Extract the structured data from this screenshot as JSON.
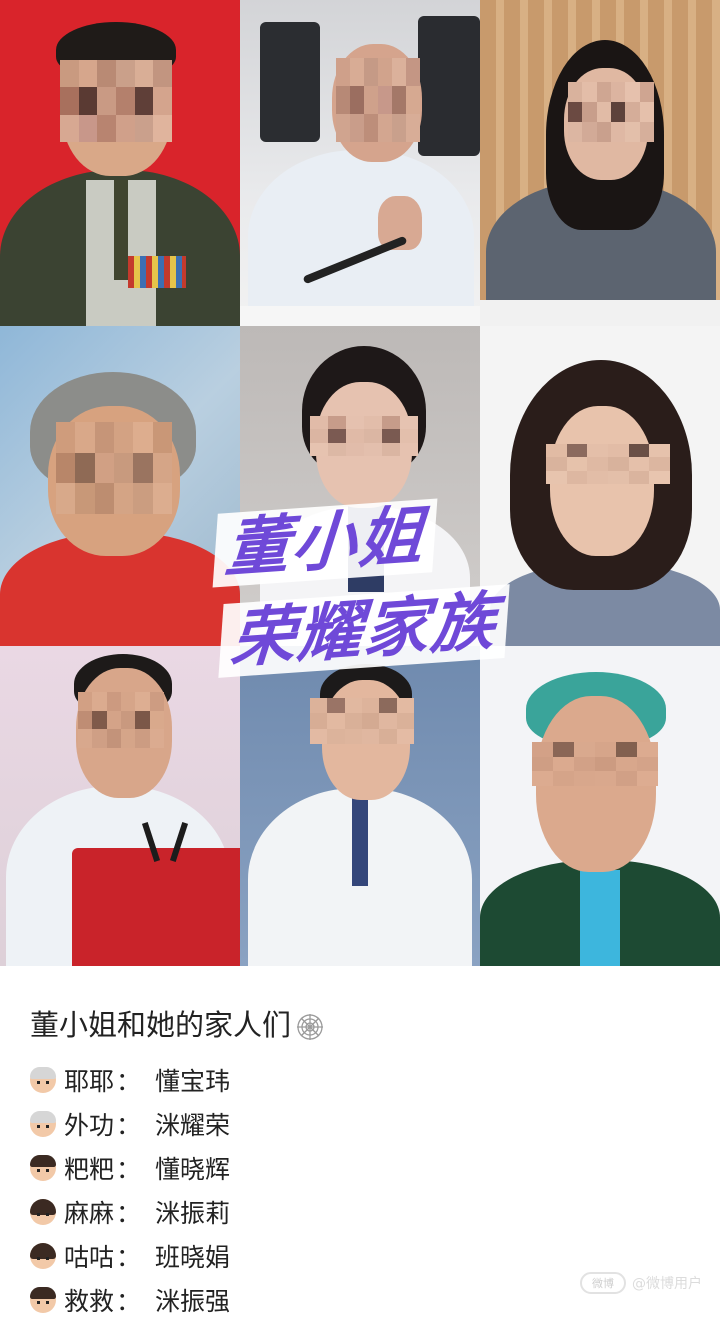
{
  "overlay": {
    "line1": "董小姐",
    "line2": "荣耀家族",
    "color": "#6f49d8"
  },
  "caption": {
    "title": "董小姐和她的家人们",
    "title_icon": "spider-web-icon",
    "members": [
      {
        "icon": "older-man-emoji-icon",
        "relation": "耶耶",
        "name": "懂宝玮"
      },
      {
        "icon": "older-man-emoji-icon",
        "relation": "外功",
        "name": "洣耀荣"
      },
      {
        "icon": "man-emoji-icon",
        "relation": "粑粑",
        "name": "懂晓辉"
      },
      {
        "icon": "woman-emoji-icon",
        "relation": "麻麻",
        "name": "洣振莉"
      },
      {
        "icon": "woman-emoji-icon",
        "relation": "咕咕",
        "name": "班晓娟"
      },
      {
        "icon": "man-emoji-icon",
        "relation": "救救",
        "name": "洣振强"
      }
    ],
    "colon": "："
  },
  "photos": [
    {
      "id": "photo-1",
      "background": "#d9242b"
    },
    {
      "id": "photo-2",
      "background": "#e7e8ea"
    },
    {
      "id": "photo-3",
      "background": "#c79a6a"
    },
    {
      "id": "photo-4",
      "background": "#7faad0"
    },
    {
      "id": "photo-5",
      "background": "#c9c6c4"
    },
    {
      "id": "photo-6",
      "background": "#f4f4f4"
    },
    {
      "id": "photo-7",
      "background": "#e6dbe2"
    },
    {
      "id": "photo-8",
      "background": "#7d96b6"
    },
    {
      "id": "photo-9",
      "background": "#f3f4f7"
    }
  ],
  "watermark": {
    "logo": "微博",
    "text": "@微博用户"
  }
}
